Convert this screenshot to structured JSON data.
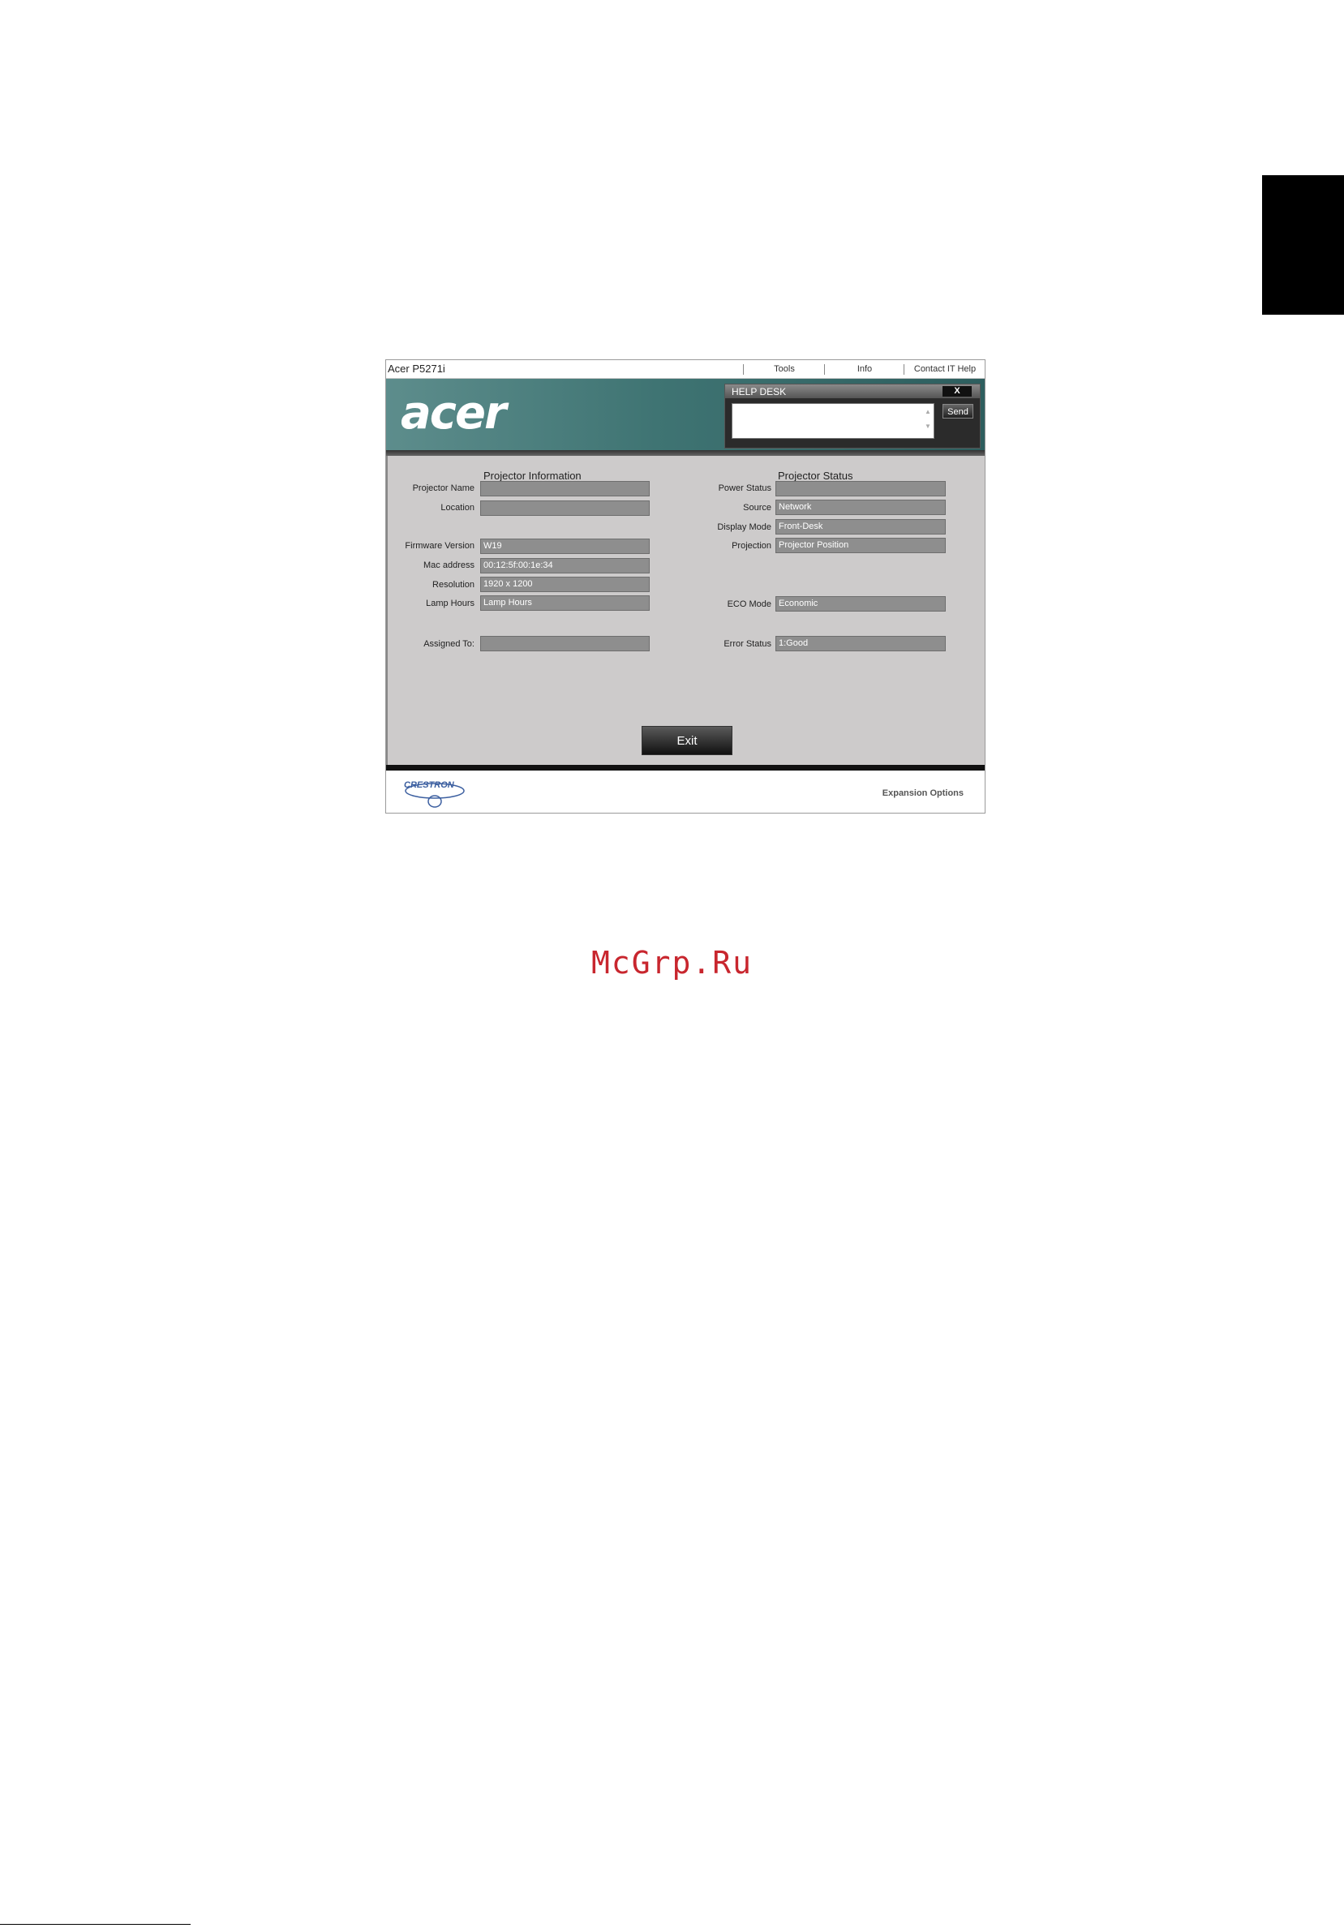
{
  "window": {
    "title": "Acer P5271i",
    "menu": [
      "Tools",
      "Info",
      "Contact IT Help"
    ]
  },
  "banner": {
    "logo_text": "acer"
  },
  "helpdesk": {
    "title": "HELP DESK",
    "close_label": "X",
    "message_value": "",
    "send_label": "Send"
  },
  "projector_info": {
    "title": "Projector Information",
    "fields": [
      {
        "label": "Projector Name",
        "value": ""
      },
      {
        "label": "Location",
        "value": ""
      },
      {
        "label": "Firmware Version",
        "value": "W19"
      },
      {
        "label": "Mac address",
        "value": "00:12:5f:00:1e:34"
      },
      {
        "label": "Resolution",
        "value": "1920 x 1200"
      },
      {
        "label": "Lamp Hours",
        "value": "Lamp Hours"
      },
      {
        "label": "Assigned To:",
        "value": ""
      }
    ]
  },
  "projector_status": {
    "title": "Projector Status",
    "fields": [
      {
        "label": "Power Status",
        "value": ""
      },
      {
        "label": "Source",
        "value": "Network"
      },
      {
        "label": "Display Mode",
        "value": "Front-Desk"
      },
      {
        "label": "Projection",
        "value": "Projector Position"
      },
      {
        "label": "ECO Mode",
        "value": "Economic"
      },
      {
        "label": "Error Status",
        "value": "1:Good"
      }
    ]
  },
  "exit_label": "Exit",
  "footer": {
    "brand": "CRESTRON",
    "expansion_label": "Expansion Options"
  },
  "watermark": "McGrp.Ru",
  "colors": {
    "banner": "#3f7473",
    "content_bg": "#cdcbcb",
    "field_bg": "#8e8e8e",
    "watermark": "#c8262e"
  }
}
